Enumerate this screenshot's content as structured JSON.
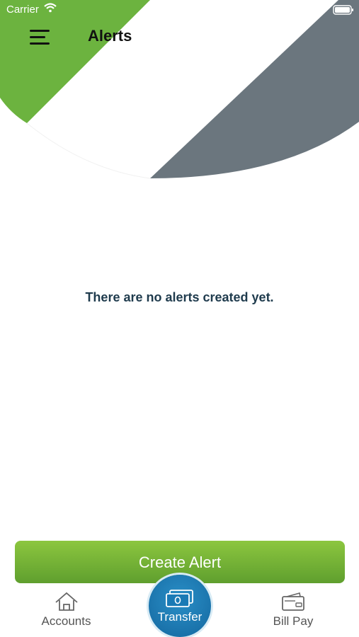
{
  "status_bar": {
    "carrier": "Carrier"
  },
  "header": {
    "title": "Alerts"
  },
  "main": {
    "empty_message": "There are no alerts created yet."
  },
  "actions": {
    "create_alert_label": "Create Alert"
  },
  "tab_bar": {
    "items": [
      {
        "label": "Accounts",
        "icon": "home-icon"
      },
      {
        "label": "Transfer",
        "icon": "money-icon"
      },
      {
        "label": "Bill Pay",
        "icon": "wallet-icon"
      }
    ]
  },
  "colors": {
    "brand_green": "#6cb33f",
    "brand_slate": "#6b767e",
    "transfer_blue": "#1a7ab5",
    "message_text": "#1f3b4d"
  }
}
